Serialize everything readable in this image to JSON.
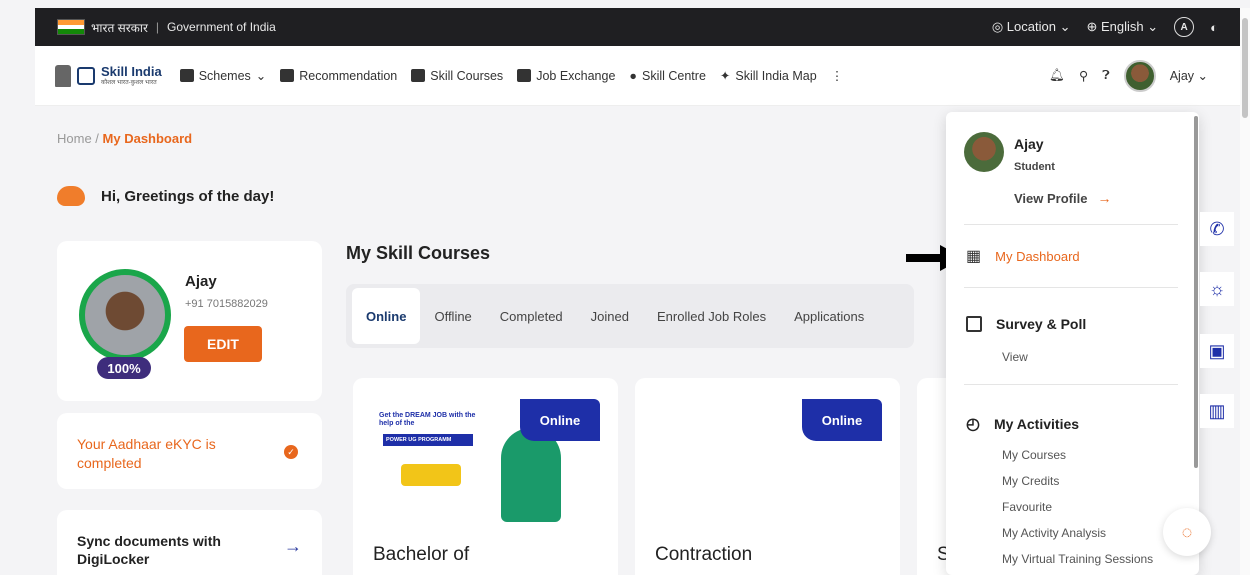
{
  "govbar": {
    "hindi": "भारत सरकार",
    "english": "Government of India",
    "location": "Location",
    "language": "English",
    "accessibility": "A"
  },
  "nav": {
    "logo_title": "Skill India",
    "logo_sub": "कौशल भारत-कुशल भारत",
    "items": [
      "Schemes",
      "Recommendation",
      "Skill Courses",
      "Job Exchange",
      "Skill Centre",
      "Skill India Map"
    ],
    "more": "⋮",
    "user": "Ajay"
  },
  "breadcrumb": {
    "home": "Home",
    "current": "My Dashboard"
  },
  "greeting": "Hi, Greetings of the day!",
  "profile": {
    "name": "Ajay",
    "phone": "+91 7015882029",
    "edit": "EDIT",
    "completion": "100%"
  },
  "kyc": {
    "text": "Your Aadhaar eKYC is completed"
  },
  "sync": {
    "text": "Sync documents with DigiLocker"
  },
  "courses": {
    "title": "My Skill Courses",
    "tabs": [
      "Online",
      "Offline",
      "Completed",
      "Joined",
      "Enrolled Job Roles",
      "Applications"
    ],
    "cards": [
      {
        "badge": "Online",
        "title": "Bachelor of",
        "banner_text": "Get the DREAM JOB with the help of the",
        "banner_strip": "POWER UG PROGRAMM"
      },
      {
        "badge": "Online",
        "title": "Contraction"
      }
    ],
    "partial_title": "S"
  },
  "dropdown": {
    "name": "Ajay",
    "role": "Student",
    "view_profile": "View Profile",
    "dashboard": "My Dashboard",
    "survey": "Survey & Poll",
    "survey_view": "View",
    "activities": "My Activities",
    "activity_items": [
      "My Courses",
      "My Credits",
      "Favourite",
      "My Activity Analysis",
      "My Virtual Training Sessions"
    ]
  },
  "colors": {
    "accent": "#e8671d",
    "primary": "#1e2fa8",
    "dark": "#1f1f22"
  }
}
